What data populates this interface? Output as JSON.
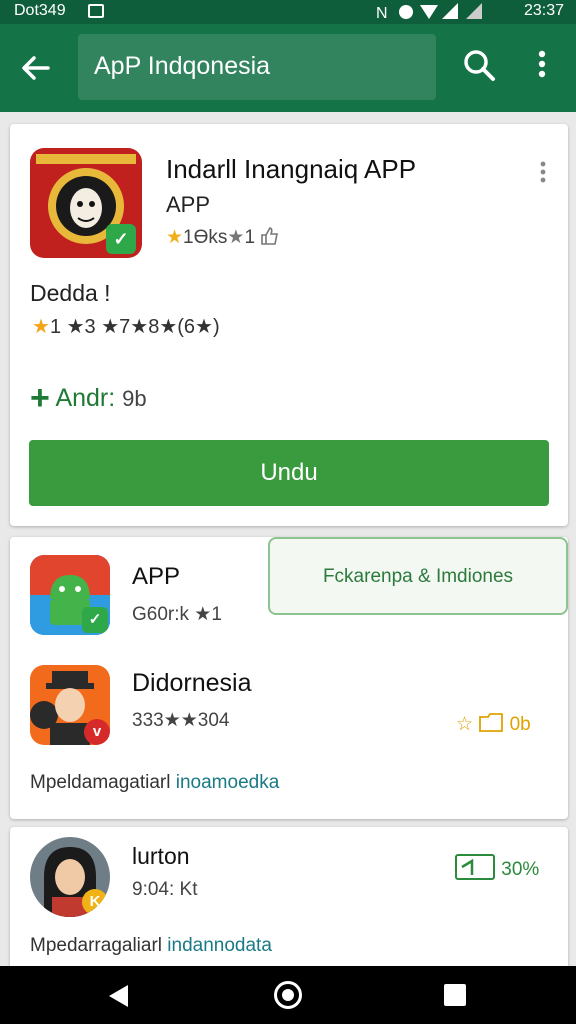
{
  "status_bar": {
    "left_text": "Dot349",
    "time": "23:37"
  },
  "app_bar": {
    "search_text": "ApP Indqonesia"
  },
  "featured": {
    "title": "Indarll Inangnaiq APP",
    "subtitle": "APP",
    "meta": "1Ɵks",
    "meta_suffix": "1",
    "section_label": "Dedda !",
    "rating_text": "1  ★3  ★7★8★",
    "rating_count": "(6★)",
    "add_label": "Andr:",
    "add_value": "9b",
    "install_label": "Undu"
  },
  "popup_text": "Fckarenpa & Imdiones",
  "list": [
    {
      "title": "APP",
      "meta": "G60r:k ★1",
      "icon": "android-robot-icon"
    },
    {
      "title": "Didornesia",
      "meta": "333★★304",
      "right_value": "0b",
      "icon": "man-hat-icon"
    }
  ],
  "card2_desc": {
    "plain": "Mpeldamagatiarl",
    "link": "inoamoedka"
  },
  "card3": {
    "title": "lurton",
    "meta": "9:04: Kt",
    "right_value": "30%",
    "desc_plain": "Mpedarragaliarl",
    "desc_link": "indannodata"
  }
}
